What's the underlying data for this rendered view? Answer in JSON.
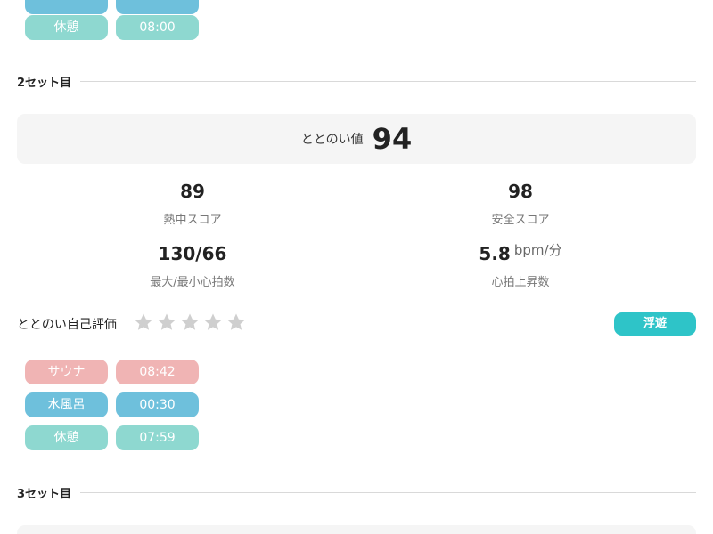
{
  "set1": {
    "rows": [
      {
        "label": "",
        "value": ""
      },
      {
        "label": "休憩",
        "value": "08:00"
      }
    ]
  },
  "set2": {
    "title": "2セット目",
    "totonoi_label": "ととのい値",
    "totonoi_value": "94",
    "heat_score": {
      "value": "89",
      "label": "熱中スコア"
    },
    "safety_score": {
      "value": "98",
      "label": "安全スコア"
    },
    "heart_rate": {
      "value": "130/66",
      "label": "最大/最小心拍数"
    },
    "heart_rise": {
      "value": "5.8",
      "unit": "bpm/分",
      "label": "心拍上昇数"
    },
    "self_eval_label": "ととのい自己評価",
    "rating": 0,
    "rating_max": 5,
    "status": "浮遊",
    "rows": [
      {
        "label": "サウナ",
        "value": "08:42"
      },
      {
        "label": "水風呂",
        "value": "00:30"
      },
      {
        "label": "休憩",
        "value": "07:59"
      }
    ]
  },
  "set3": {
    "title": "3セット目"
  },
  "colors": {
    "sauna": "#f0b4b4",
    "water": "#6ec0dc",
    "rest": "#8ed8d0",
    "status": "#2ec4c8",
    "star_empty": "#cfcfcf"
  }
}
